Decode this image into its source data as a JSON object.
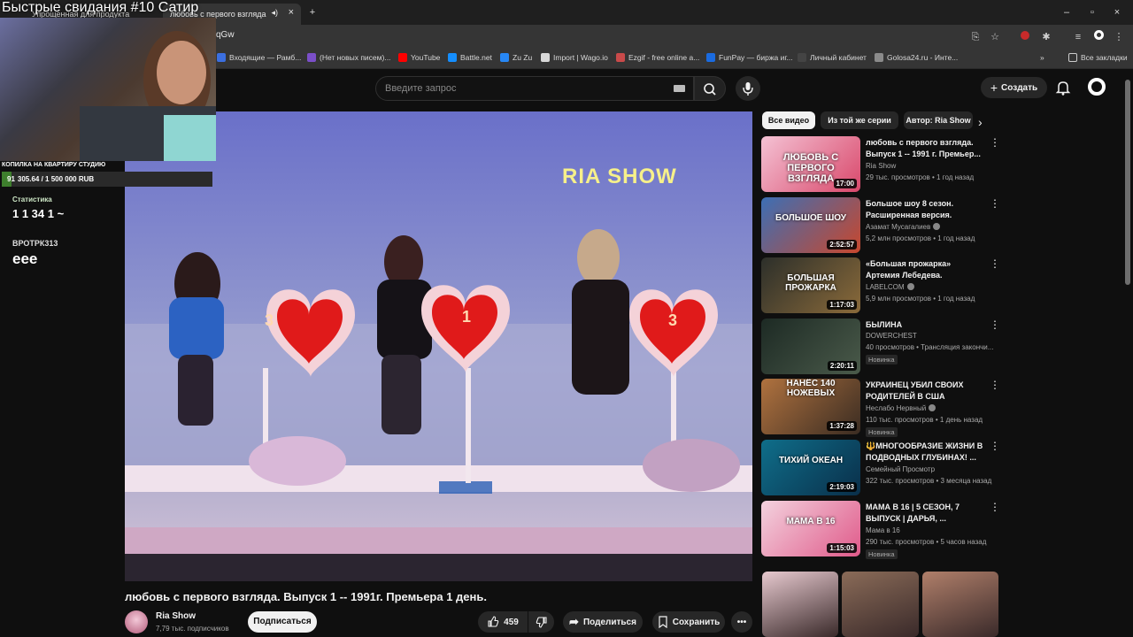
{
  "overlay": {
    "title": "Быстрые свидания #10 Сатир",
    "goal_label": "КОПИЛКА НА КВАРТИРУ СТУДИЮ",
    "goal_text": "305.64 / 1 500 000 RUB",
    "goal_prefix": "91",
    "goal_progress": 0.0002,
    "stats_label": "Статистика",
    "stats_values": "1  1  34  1 ~",
    "chat_user": "ВРОТРК313",
    "chat_message": "eee"
  },
  "browser": {
    "tabs": [
      {
        "label": "Упрощенная для продукта"
      },
      {
        "label": "любовь с первого взгляда"
      }
    ],
    "url": "qGw",
    "bookmarks": [
      {
        "label": "Входящие — Рамб...",
        "color": "#3b6fe0"
      },
      {
        "label": "(Нет новых писем)...",
        "color": "#7b4fc9"
      },
      {
        "label": "YouTube",
        "color": "#ff0000"
      },
      {
        "label": "Battle.net",
        "color": "#148eff"
      },
      {
        "label": "Zu Zu",
        "color": "#2787f5"
      },
      {
        "label": "Import | Wago.io",
        "color": "#d8d8d8"
      },
      {
        "label": "Ezgif - free online a...",
        "color": "#c94a4a"
      },
      {
        "label": "FunPay — биржа иг...",
        "color": "#1a6be0"
      },
      {
        "label": "Личный кабинет",
        "color": "#444444"
      },
      {
        "label": "Golosa24.ru - Инте...",
        "color": "#8a8a8a"
      },
      {
        "label": "Все закладки",
        "color": "#353535"
      }
    ]
  },
  "header": {
    "search_placeholder": "Введите запрос",
    "create_label": "Создать"
  },
  "video": {
    "overlay_text": "RIA SHOW",
    "heart_numbers": [
      "3",
      "1",
      "3"
    ],
    "title": "любовь с первого взгляда. Выпуск 1 -- 1991г. Премьера 1 день.",
    "channel": "Ria Show",
    "subscribers": "7,79 тыс. подписчиков",
    "subscribe_label": "Подписаться",
    "likes": "459",
    "share_label": "Поделиться",
    "save_label": "Сохранить"
  },
  "sidebar": {
    "chips": [
      "Все видео",
      "Из той же серии",
      "Автор: Ria Show"
    ],
    "items": [
      {
        "title": "любовь с первого взгляда. Выпуск 1 -- 1991 г. Премьер...",
        "channel": "Ria Show",
        "verified": false,
        "meta": "29 тыс. просмотров • 1 год назад",
        "duration": "17:00",
        "badge": "",
        "thumb_text": "ЛЮБОВЬ С ПЕРВОГО ВЗГЛЯДА",
        "color_a": "#f4c2d4",
        "color_b": "#d9486b"
      },
      {
        "title": "Большое шоу 8 сезон. Расширенная версия.",
        "channel": "Азамат Мусагалиев",
        "verified": true,
        "meta": "5,2 млн просмотров • 1 год назад",
        "duration": "2:52:57",
        "badge": "",
        "thumb_text": "БОЛЬШОЕ ШОУ",
        "color_a": "#3c6fb5",
        "color_b": "#c8472d"
      },
      {
        "title": "«Большая прожарка» Артемия Лебедева.",
        "channel": "LABELCOM",
        "verified": true,
        "meta": "5,9 млн просмотров • 1 год назад",
        "duration": "1:17:03",
        "badge": "",
        "thumb_text": "БОЛЬШАЯ ПРОЖАРКА",
        "color_a": "#2c2f2a",
        "color_b": "#8a6a3a"
      },
      {
        "title": "БЫЛИНА",
        "channel": "DOWERCHEST",
        "verified": false,
        "meta": "40 просмотров • Трансляция закончи...",
        "duration": "2:20:11",
        "badge": "Новинка",
        "thumb_text": "",
        "color_a": "#1d2a24",
        "color_b": "#4a5a4a"
      },
      {
        "title": "УКРАИНЕЦ УБИЛ СВОИХ РОДИТЕЛЕЙ В США",
        "channel": "Неслабо Нервный",
        "verified": true,
        "meta": "110 тыс. просмотров • 1 день назад",
        "duration": "1:37:28",
        "badge": "Новинка",
        "thumb_text": "НАНЁС 140 НОЖЕВЫХ",
        "color_a": "#b0723f",
        "color_b": "#3a2c22"
      },
      {
        "title": "🔱МНОГООБРАЗИЕ ЖИЗНИ В ПОДВОДНЫХ ГЛУБИНАХ! ...",
        "channel": "Семейный Просмотр",
        "verified": false,
        "meta": "322 тыс. просмотров • 3 месяца назад",
        "duration": "2:19:03",
        "badge": "",
        "thumb_text": "ТИХИЙ ОКЕАН",
        "color_a": "#0f6e8a",
        "color_b": "#0a2f4a"
      },
      {
        "title": "МАМА В 16 | 5 СЕЗОН, 7 ВЫПУСК | ДАРЬЯ, ...",
        "channel": "Мама в 16",
        "verified": false,
        "meta": "290 тыс. просмотров • 5 часов назад",
        "duration": "1:15:03",
        "badge": "Новинка",
        "thumb_text": "МАМА В 16",
        "color_a": "#f3d2de",
        "color_b": "#e05a8a"
      }
    ],
    "shorts_colors": [
      "#e7c9cf",
      "#8a6b58",
      "#b07f6a"
    ]
  }
}
